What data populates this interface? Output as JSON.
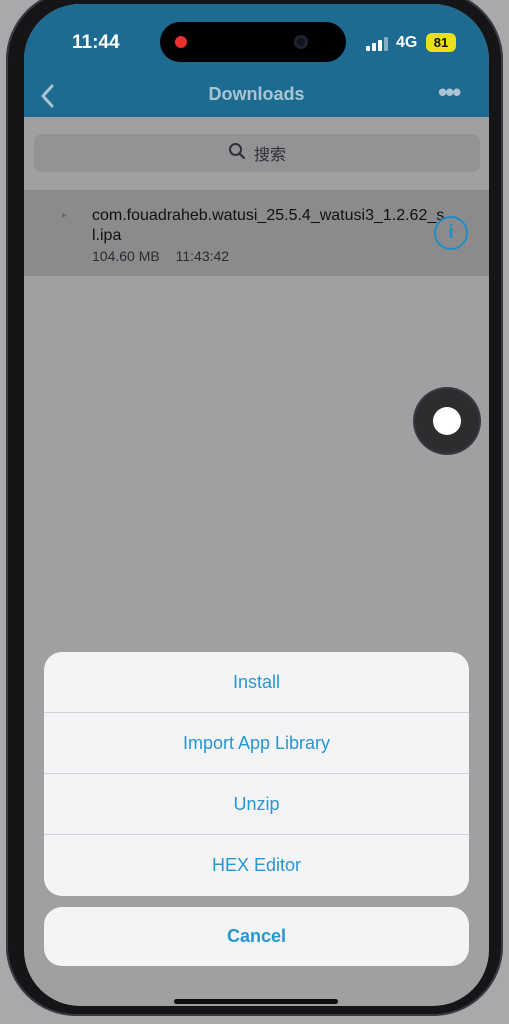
{
  "status": {
    "time": "11:44",
    "network": "4G",
    "battery": "81"
  },
  "nav": {
    "title": "Downloads"
  },
  "search": {
    "placeholder": "搜索"
  },
  "file": {
    "name": "com.fouadraheb.watusi_25.5.4_watusi3_1.2.62_sl.ipa",
    "size": "104.60 MB",
    "time": "11:43:42"
  },
  "actions": {
    "install": "Install",
    "import": "Import App Library",
    "unzip": "Unzip",
    "hex": "HEX Editor",
    "cancel": "Cancel"
  },
  "colors": {
    "nav_bar": "#1d6b91",
    "accent": "#2697cf",
    "battery": "#e9df1b",
    "record_dot": "#e8312e"
  },
  "icons": [
    "back-chevron-icon",
    "more-icon",
    "search-icon",
    "file-icon",
    "info-icon",
    "signal-icon",
    "battery-icon"
  ]
}
